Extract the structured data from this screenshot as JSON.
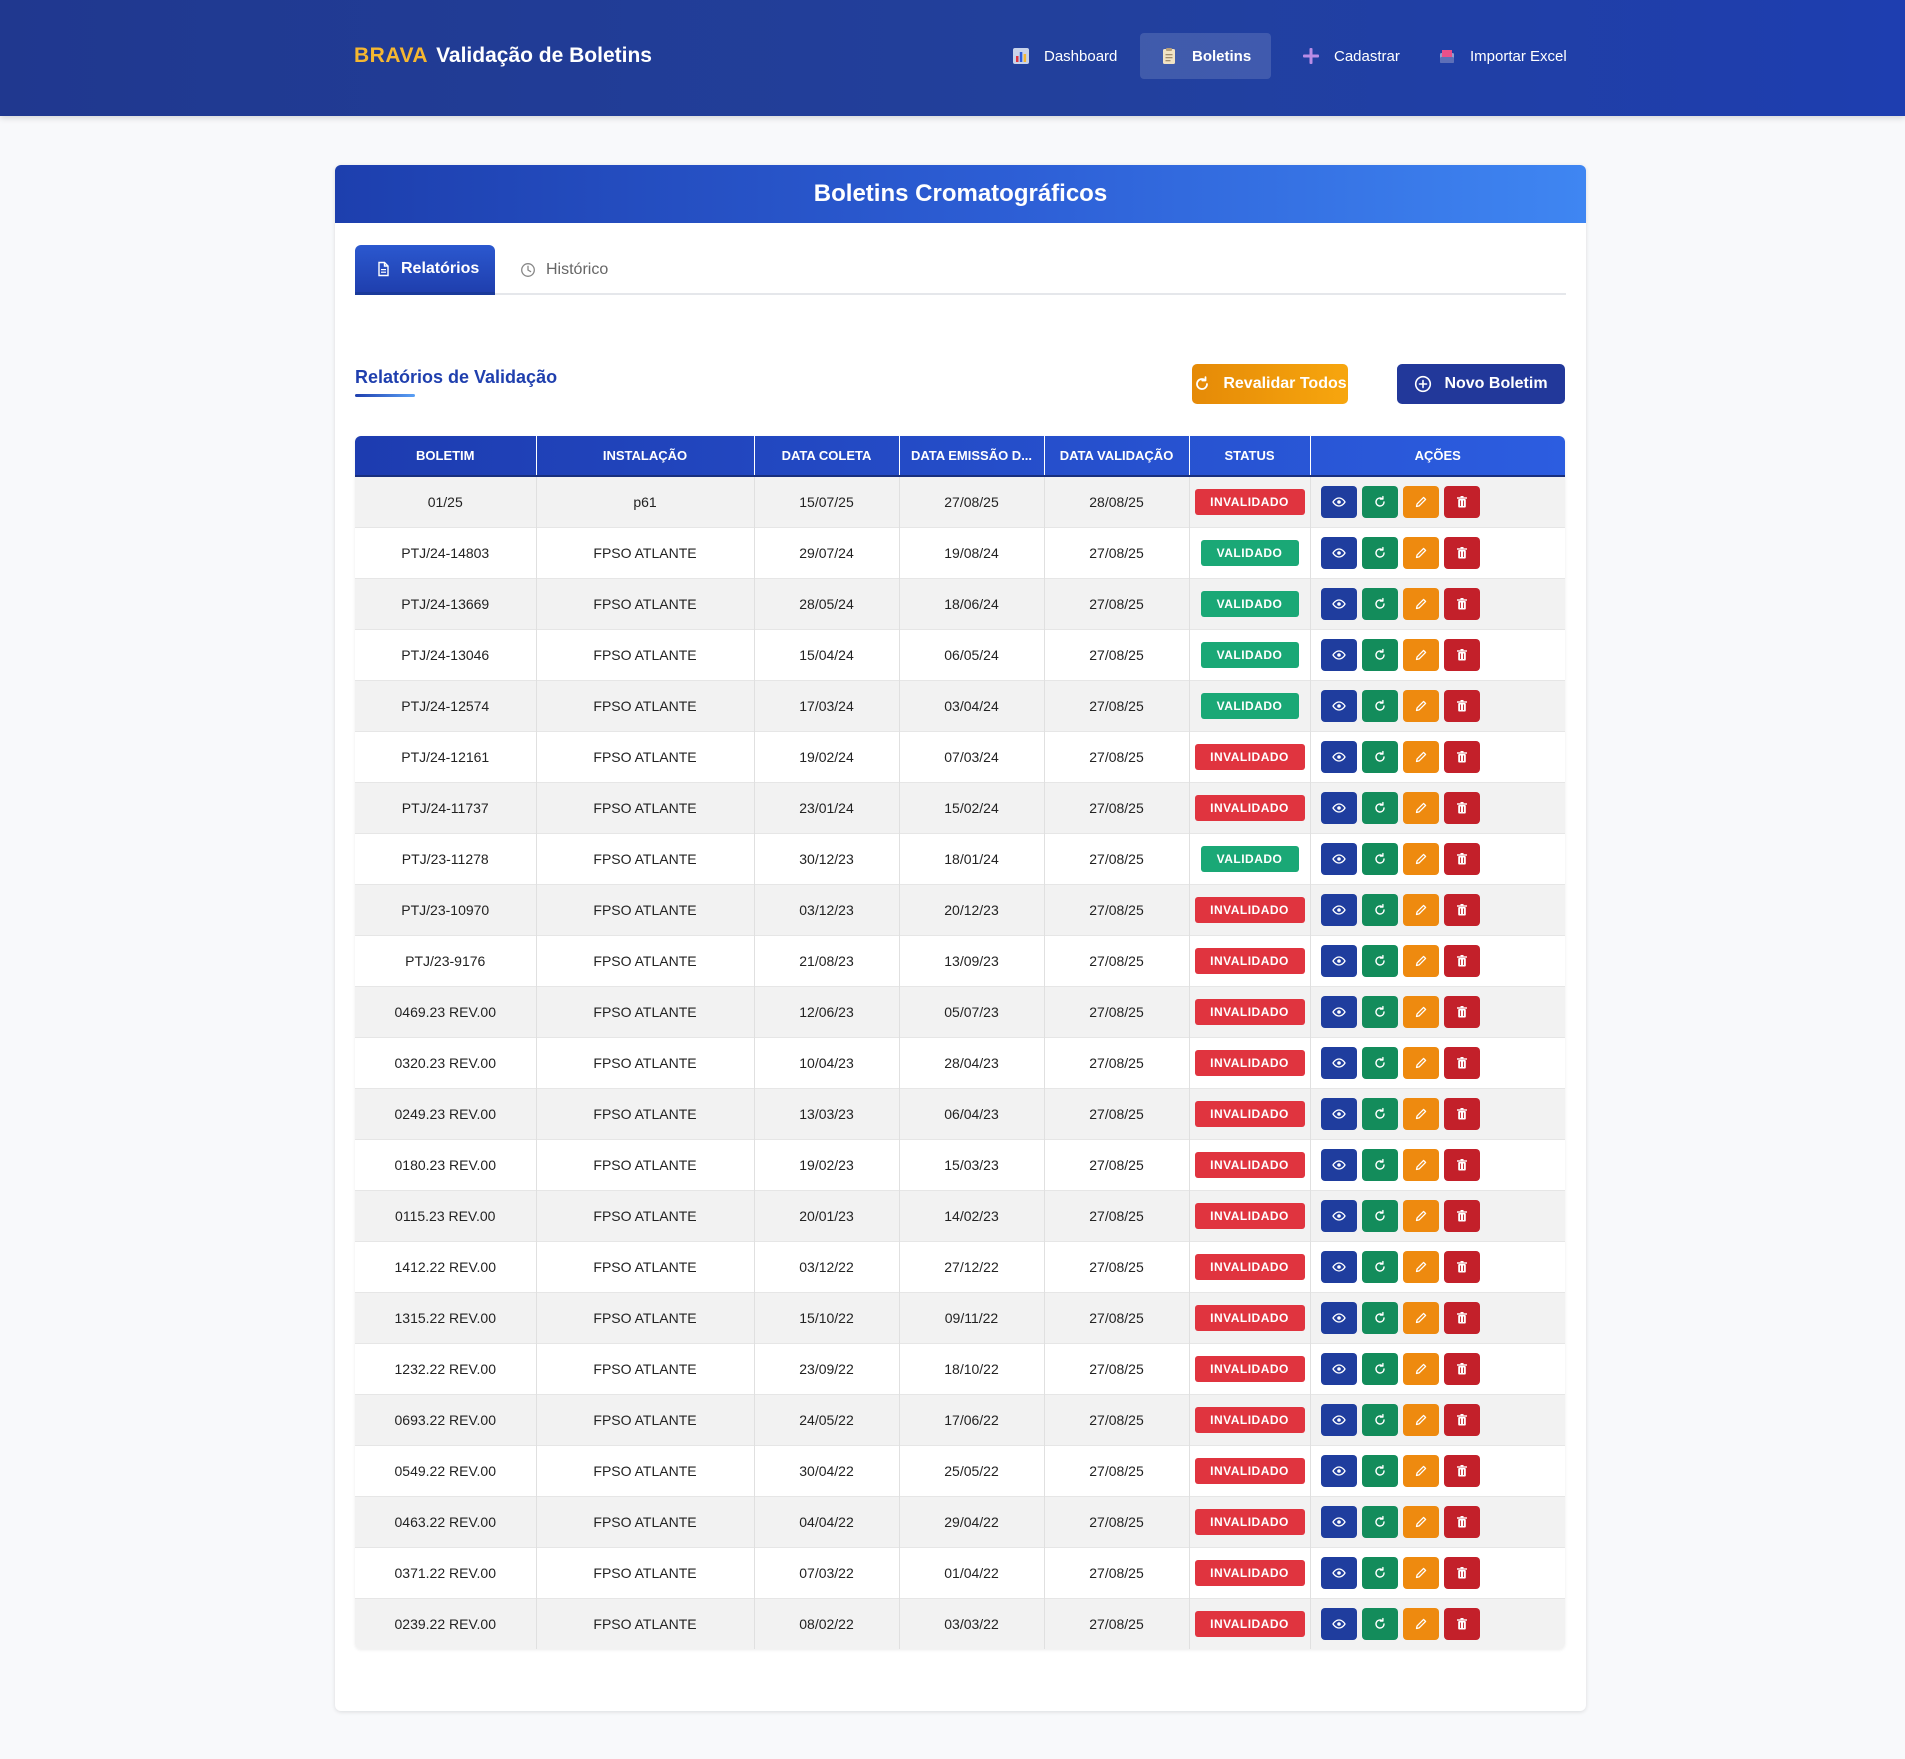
{
  "navbar": {
    "brand_logo": "BRAVA",
    "brand_title": "Validação de Boletins",
    "items": [
      {
        "label": "Dashboard",
        "icon": "bar-chart-icon",
        "active": false
      },
      {
        "label": "Boletins",
        "icon": "clipboard-icon",
        "active": true
      },
      {
        "label": "Cadastrar",
        "icon": "plus-icon",
        "active": false
      },
      {
        "label": "Importar Excel",
        "icon": "inbox-tray-icon",
        "active": false
      }
    ]
  },
  "card": {
    "title": "Boletins Cromatográficos",
    "tabs": [
      {
        "label": "Relatórios",
        "icon": "document-icon",
        "active": true
      },
      {
        "label": "Histórico",
        "icon": "clock-icon",
        "active": false
      }
    ],
    "section_title": "Relatórios de Validação",
    "buttons": {
      "revalidate_all": "Revalidar Todos",
      "new_bulletin": "Novo Boletim"
    }
  },
  "table": {
    "columns": [
      "Boletim",
      "Instalação",
      "Data Coleta",
      "Data Emissão D...",
      "Data Validação",
      "Status",
      "Ações"
    ],
    "rows": [
      {
        "boletim": "01/25",
        "instalacao": "p61",
        "coleta": "15/07/25",
        "emissao": "27/08/25",
        "validacao": "28/08/25",
        "status": "INVALIDADO"
      },
      {
        "boletim": "PTJ/24-14803",
        "instalacao": "FPSO ATLANTE",
        "coleta": "29/07/24",
        "emissao": "19/08/24",
        "validacao": "27/08/25",
        "status": "VALIDADO"
      },
      {
        "boletim": "PTJ/24-13669",
        "instalacao": "FPSO ATLANTE",
        "coleta": "28/05/24",
        "emissao": "18/06/24",
        "validacao": "27/08/25",
        "status": "VALIDADO"
      },
      {
        "boletim": "PTJ/24-13046",
        "instalacao": "FPSO ATLANTE",
        "coleta": "15/04/24",
        "emissao": "06/05/24",
        "validacao": "27/08/25",
        "status": "VALIDADO"
      },
      {
        "boletim": "PTJ/24-12574",
        "instalacao": "FPSO ATLANTE",
        "coleta": "17/03/24",
        "emissao": "03/04/24",
        "validacao": "27/08/25",
        "status": "VALIDADO"
      },
      {
        "boletim": "PTJ/24-12161",
        "instalacao": "FPSO ATLANTE",
        "coleta": "19/02/24",
        "emissao": "07/03/24",
        "validacao": "27/08/25",
        "status": "INVALIDADO"
      },
      {
        "boletim": "PTJ/24-11737",
        "instalacao": "FPSO ATLANTE",
        "coleta": "23/01/24",
        "emissao": "15/02/24",
        "validacao": "27/08/25",
        "status": "INVALIDADO"
      },
      {
        "boletim": "PTJ/23-11278",
        "instalacao": "FPSO ATLANTE",
        "coleta": "30/12/23",
        "emissao": "18/01/24",
        "validacao": "27/08/25",
        "status": "VALIDADO"
      },
      {
        "boletim": "PTJ/23-10970",
        "instalacao": "FPSO ATLANTE",
        "coleta": "03/12/23",
        "emissao": "20/12/23",
        "validacao": "27/08/25",
        "status": "INVALIDADO"
      },
      {
        "boletim": "PTJ/23-9176",
        "instalacao": "FPSO ATLANTE",
        "coleta": "21/08/23",
        "emissao": "13/09/23",
        "validacao": "27/08/25",
        "status": "INVALIDADO"
      },
      {
        "boletim": "0469.23 REV.00",
        "instalacao": "FPSO ATLANTE",
        "coleta": "12/06/23",
        "emissao": "05/07/23",
        "validacao": "27/08/25",
        "status": "INVALIDADO"
      },
      {
        "boletim": "0320.23 REV.00",
        "instalacao": "FPSO ATLANTE",
        "coleta": "10/04/23",
        "emissao": "28/04/23",
        "validacao": "27/08/25",
        "status": "INVALIDADO"
      },
      {
        "boletim": "0249.23 REV.00",
        "instalacao": "FPSO ATLANTE",
        "coleta": "13/03/23",
        "emissao": "06/04/23",
        "validacao": "27/08/25",
        "status": "INVALIDADO"
      },
      {
        "boletim": "0180.23 REV.00",
        "instalacao": "FPSO ATLANTE",
        "coleta": "19/02/23",
        "emissao": "15/03/23",
        "validacao": "27/08/25",
        "status": "INVALIDADO"
      },
      {
        "boletim": "0115.23 REV.00",
        "instalacao": "FPSO ATLANTE",
        "coleta": "20/01/23",
        "emissao": "14/02/23",
        "validacao": "27/08/25",
        "status": "INVALIDADO"
      },
      {
        "boletim": "1412.22 REV.00",
        "instalacao": "FPSO ATLANTE",
        "coleta": "03/12/22",
        "emissao": "27/12/22",
        "validacao": "27/08/25",
        "status": "INVALIDADO"
      },
      {
        "boletim": "1315.22 REV.00",
        "instalacao": "FPSO ATLANTE",
        "coleta": "15/10/22",
        "emissao": "09/11/22",
        "validacao": "27/08/25",
        "status": "INVALIDADO"
      },
      {
        "boletim": "1232.22 REV.00",
        "instalacao": "FPSO ATLANTE",
        "coleta": "23/09/22",
        "emissao": "18/10/22",
        "validacao": "27/08/25",
        "status": "INVALIDADO"
      },
      {
        "boletim": "0693.22 REV.00",
        "instalacao": "FPSO ATLANTE",
        "coleta": "24/05/22",
        "emissao": "17/06/22",
        "validacao": "27/08/25",
        "status": "INVALIDADO"
      },
      {
        "boletim": "0549.22 REV.00",
        "instalacao": "FPSO ATLANTE",
        "coleta": "30/04/22",
        "emissao": "25/05/22",
        "validacao": "27/08/25",
        "status": "INVALIDADO"
      },
      {
        "boletim": "0463.22 REV.00",
        "instalacao": "FPSO ATLANTE",
        "coleta": "04/04/22",
        "emissao": "29/04/22",
        "validacao": "27/08/25",
        "status": "INVALIDADO"
      },
      {
        "boletim": "0371.22 REV.00",
        "instalacao": "FPSO ATLANTE",
        "coleta": "07/03/22",
        "emissao": "01/04/22",
        "validacao": "27/08/25",
        "status": "INVALIDADO"
      },
      {
        "boletim": "0239.22 REV.00",
        "instalacao": "FPSO ATLANTE",
        "coleta": "08/02/22",
        "emissao": "03/03/22",
        "validacao": "27/08/25",
        "status": "INVALIDADO"
      }
    ],
    "row_actions": [
      "eye-icon",
      "refresh-icon",
      "pencil-icon",
      "trash-icon"
    ]
  },
  "colors": {
    "navbar": "#22409c",
    "brand_accent": "#f5b731",
    "valid": "#1aa876",
    "invalid": "#e0343f",
    "action_view": "#1f3d9e",
    "action_revalidate": "#138c5b",
    "action_edit": "#ee8a0f",
    "action_delete": "#c3202a"
  }
}
